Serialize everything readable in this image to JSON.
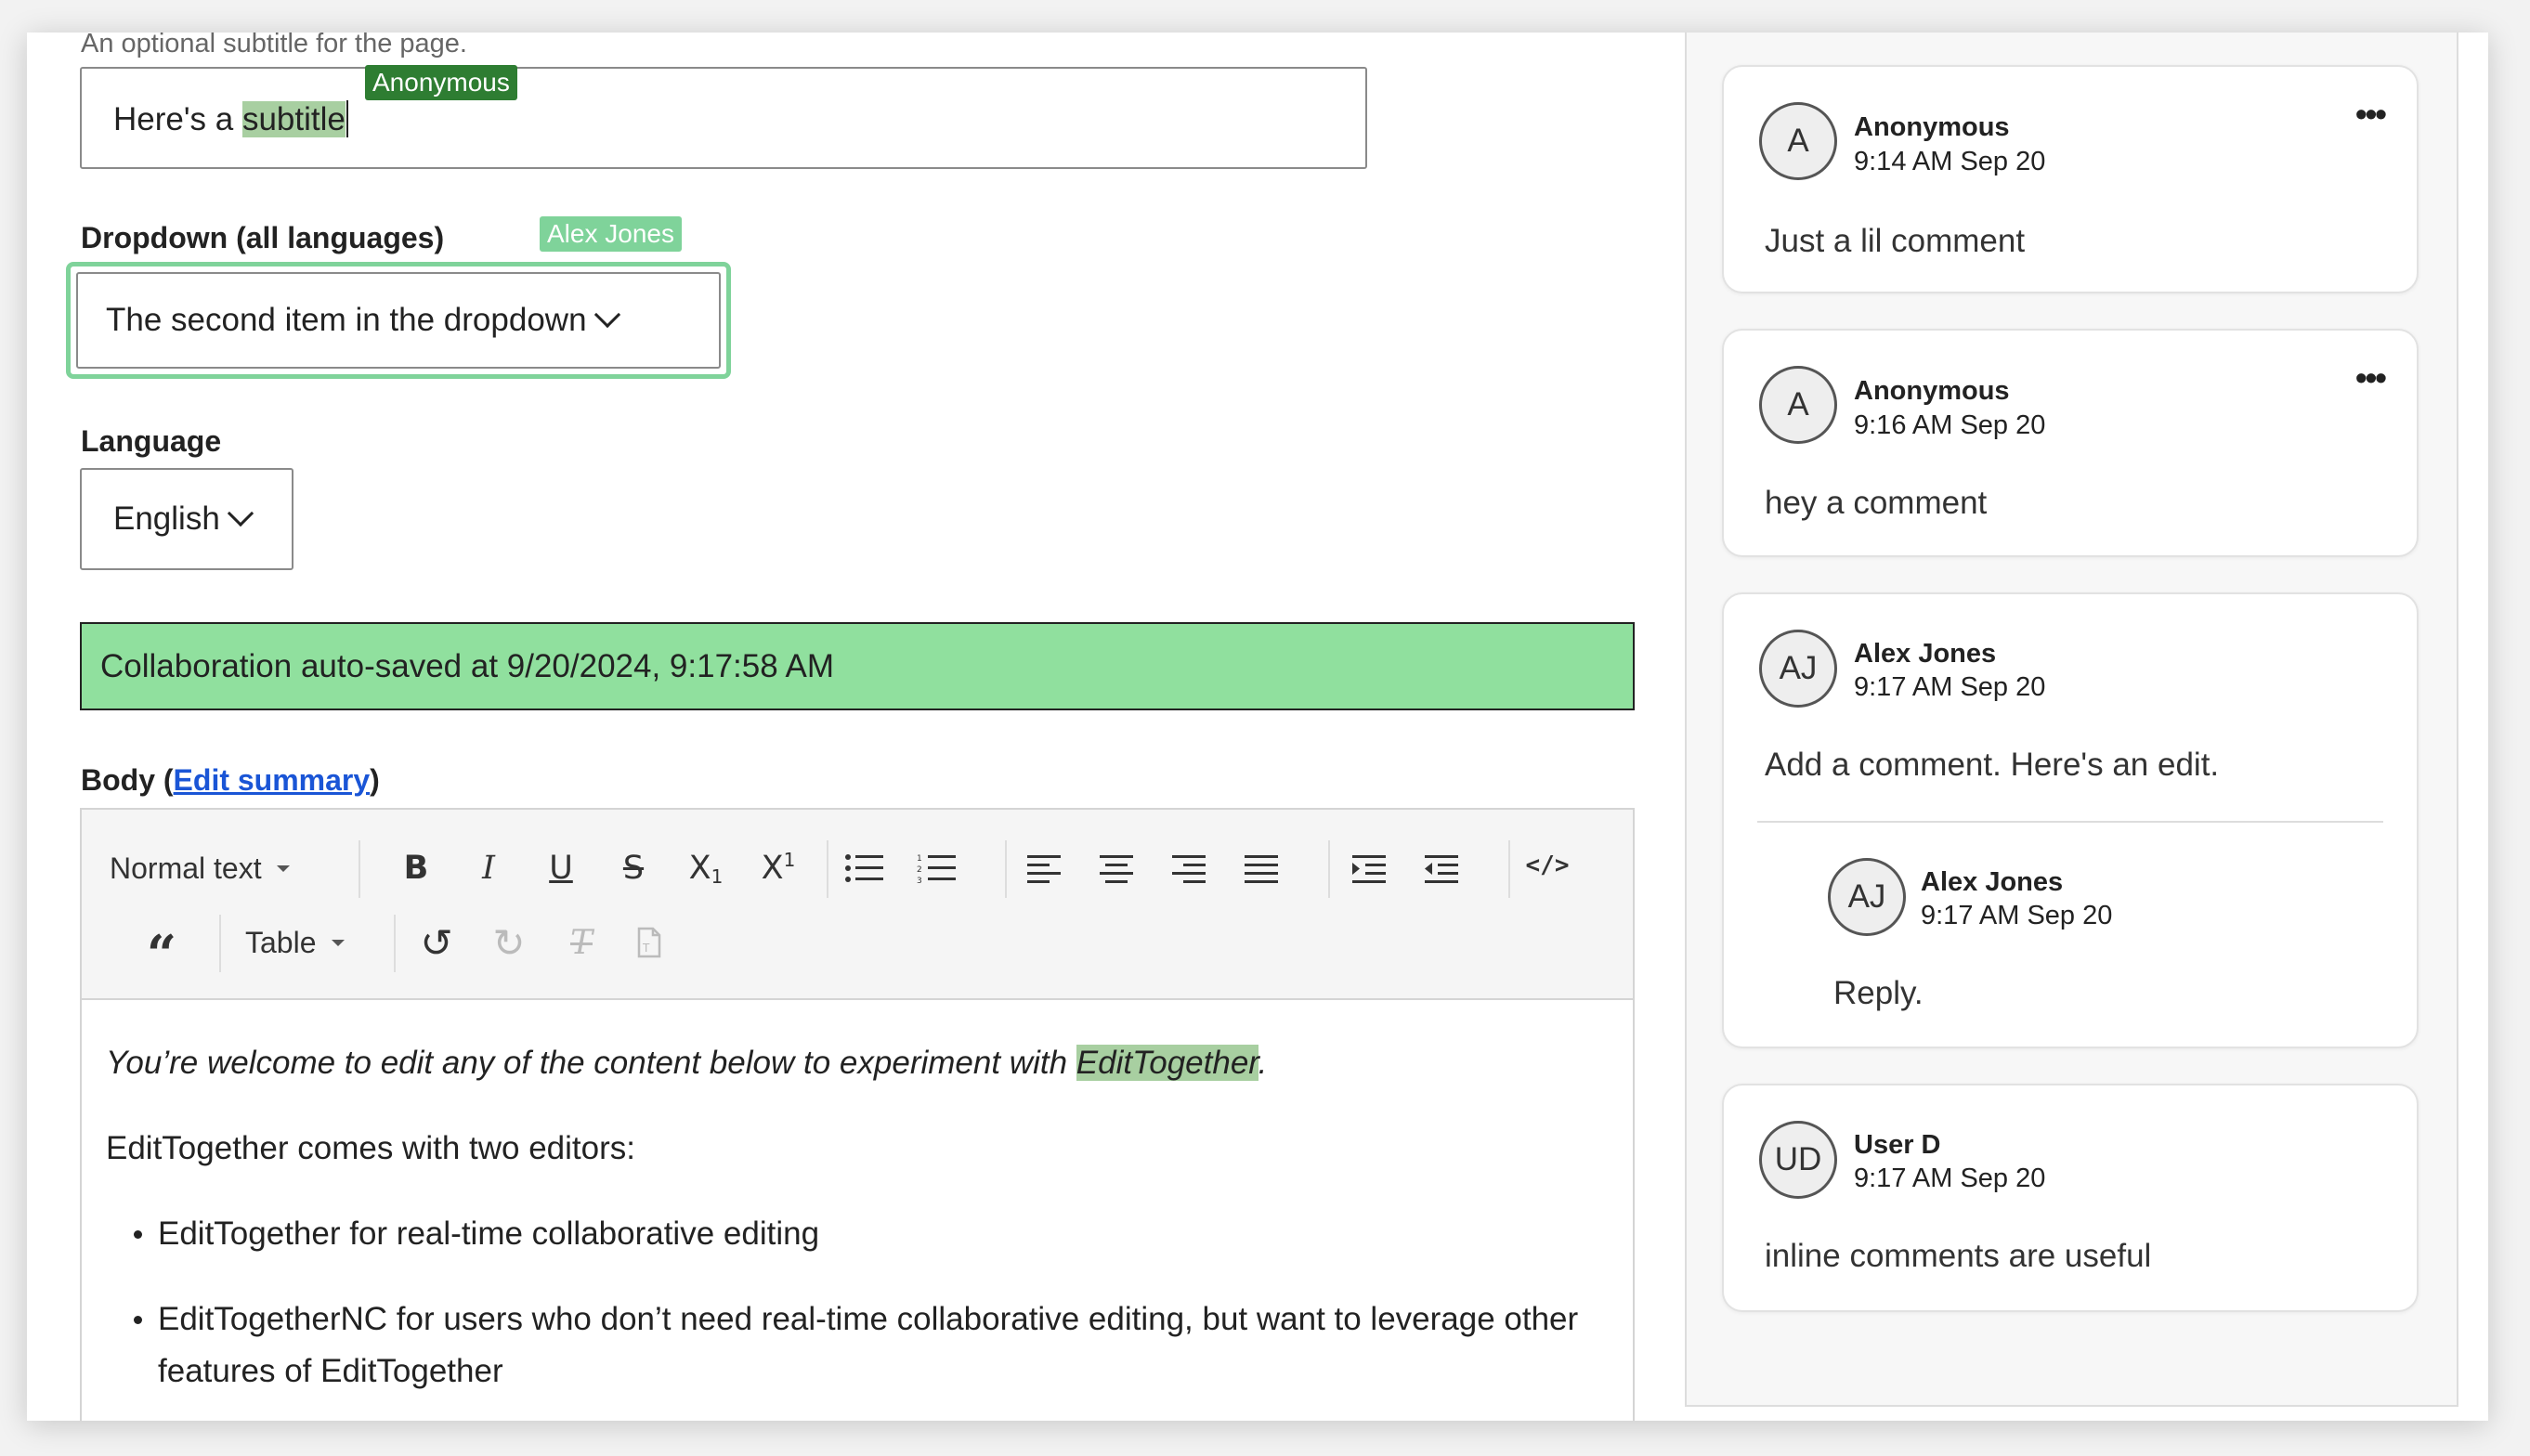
{
  "form": {
    "subtitle_hint": "An optional subtitle for the page.",
    "subtitle_value_prefix": "Here's a ",
    "subtitle_value_highlight": "subtitle",
    "subtitle_editor_tag": "Anonymous",
    "dropdown_label": "Dropdown (all languages)",
    "dropdown_editor_tag": "Alex Jones",
    "dropdown_value": "The second item in the dropdown",
    "language_label": "Language",
    "language_value": "English",
    "autosave_status": "Collaboration auto-saved at 9/20/2024, 9:17:58 AM",
    "body_label_prefix": "Body (",
    "body_label_link": "Edit summary",
    "body_label_suffix": ")"
  },
  "toolbar": {
    "block_format": "Normal text",
    "table": "Table",
    "icons": [
      "bold-icon",
      "italic-icon",
      "underline-icon",
      "strikethrough-icon",
      "subscript-icon",
      "superscript-icon",
      "bullet-list-icon",
      "numbered-list-icon",
      "align-left-icon",
      "align-center-icon",
      "align-right-icon",
      "align-justify-icon",
      "indent-icon",
      "outdent-icon",
      "source-code-icon",
      "blockquote-icon",
      "undo-icon",
      "redo-icon",
      "clear-format-icon",
      "paste-text-icon"
    ]
  },
  "editor_content": {
    "intro_prefix": "You’re welcome to edit any of the content below to experiment with ",
    "intro_highlight": "EditTogether",
    "intro_suffix": ".",
    "para2": "EditTogether comes with two editors:",
    "bullets": [
      "EditTogether for real-time collaborative editing",
      "EditTogetherNC for users who don’t need real-time collaborative editing, but want to leverage other features of EditTogether"
    ]
  },
  "comments": [
    {
      "initials": "A",
      "author": "Anonymous",
      "time": "9:14 AM Sep 20",
      "text": "Just a lil comment",
      "menu": "•••"
    },
    {
      "initials": "A",
      "author": "Anonymous",
      "time": "9:16 AM Sep 20",
      "text": "hey a comment",
      "menu": "•••"
    },
    {
      "initials": "AJ",
      "author": "Alex Jones",
      "time": "9:17 AM Sep 20",
      "text": "Add a comment. Here's an edit.",
      "reply": {
        "initials": "AJ",
        "author": "Alex Jones",
        "time": "9:17 AM Sep 20",
        "text": "Reply."
      }
    },
    {
      "initials": "UD",
      "author": "User D",
      "time": "9:17 AM Sep 20",
      "text": "inline comments are useful"
    }
  ],
  "colors": {
    "highlight": "#a8cfa1",
    "anonymous_tag": "#2e7d32",
    "alex_tag": "#7fd39a",
    "status_bg": "#90e09e",
    "link": "#1a55d6"
  }
}
